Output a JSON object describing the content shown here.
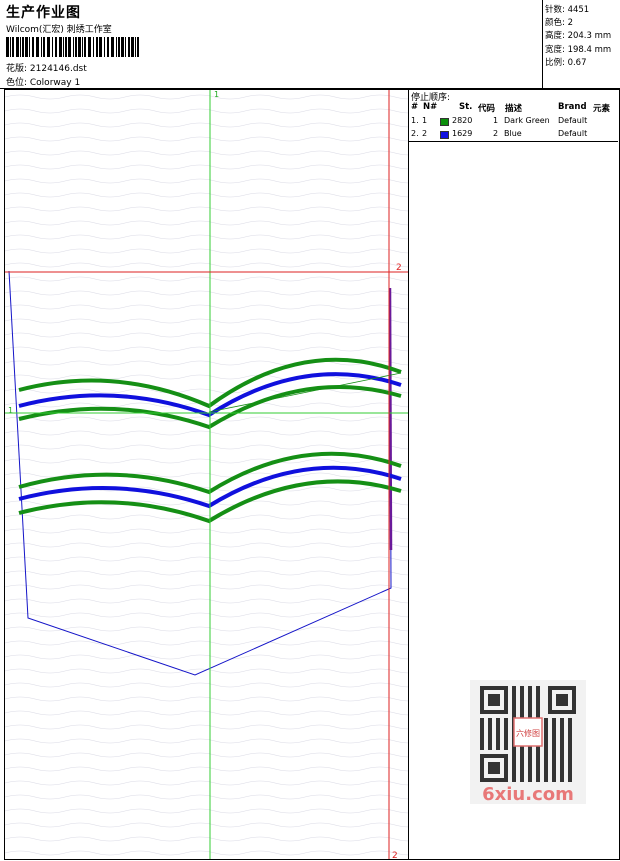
{
  "header": {
    "title": "生产作业图",
    "company": "Wilcom(汇宏) 刺绣工作室",
    "design_label": "花版: 2124146.dst",
    "colorway_label": "色位: Colorway 1"
  },
  "stats": {
    "stitches": "针数: 4451",
    "colors": "颜色: 2",
    "height": "高度: 204.3 mm",
    "width": "宽度: 198.4 mm",
    "scale": "比例: 0.67"
  },
  "panel": {
    "title": "停止顺序:",
    "columns": [
      "#",
      "N#",
      "St.",
      "代码",
      "描述",
      "Brand",
      "元素"
    ],
    "rows": [
      {
        "idx": "1.",
        "num": "1",
        "stitches": "2820",
        "code": "1",
        "desc": "Dark Green",
        "brand": "Default",
        "color": "#0a8f0a"
      },
      {
        "idx": "2.",
        "num": "2",
        "stitches": "1629",
        "code": "2",
        "desc": "Blue",
        "brand": "Default",
        "color": "#1010e0"
      }
    ]
  },
  "canvas": {
    "guide_green_label": "1",
    "guide_red_label": "2",
    "green_color": "#1a8f1a",
    "blue_color": "#1010dd"
  },
  "watermark": {
    "stamp_text": "六修图",
    "site": "6xiu.com"
  }
}
